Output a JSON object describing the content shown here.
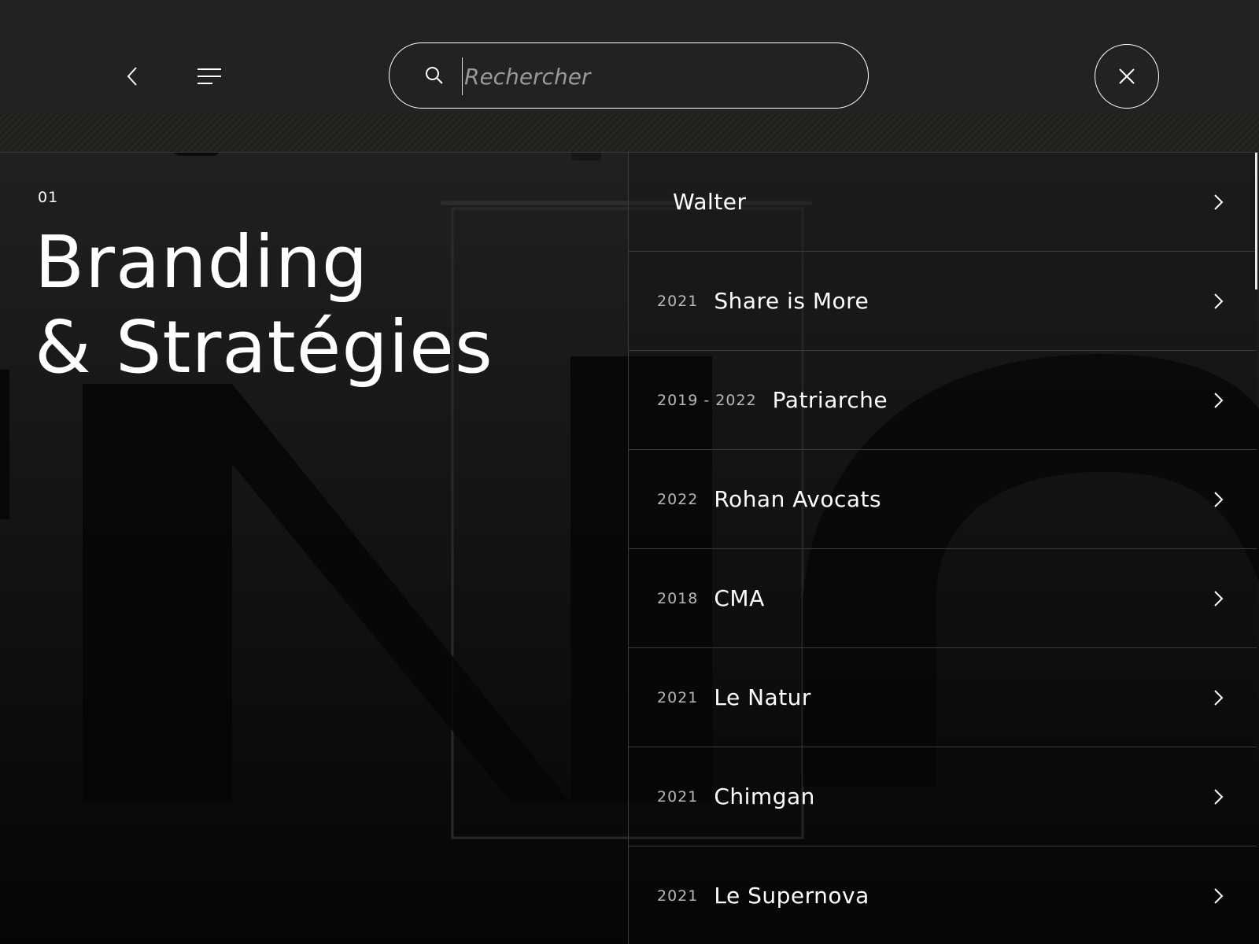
{
  "header": {
    "search": {
      "placeholder": "Rechercher",
      "value": ""
    }
  },
  "section": {
    "number": "01",
    "title_line1": "Branding",
    "title_line2": "& Stratégies"
  },
  "projects": [
    {
      "year": "",
      "name": "Walter"
    },
    {
      "year": "2021",
      "name": "Share is More"
    },
    {
      "year": "2019 - 2022",
      "name": "Patriarche"
    },
    {
      "year": "2022",
      "name": "Rohan Avocats"
    },
    {
      "year": "2018",
      "name": "CMA"
    },
    {
      "year": "2021",
      "name": "Le Natur"
    },
    {
      "year": "2021",
      "name": "Chimgan"
    },
    {
      "year": "2021",
      "name": "Le Supernova"
    }
  ],
  "icons": {
    "back": "chevron-left-icon",
    "menu": "menu-icon",
    "search": "search-icon",
    "close": "close-icon",
    "item_arrow": "chevron-right-icon"
  },
  "colors": {
    "background": "#1c1c1c",
    "text": "#ffffff",
    "muted": "#b8b8b8",
    "divider": "#3a3a3a"
  }
}
